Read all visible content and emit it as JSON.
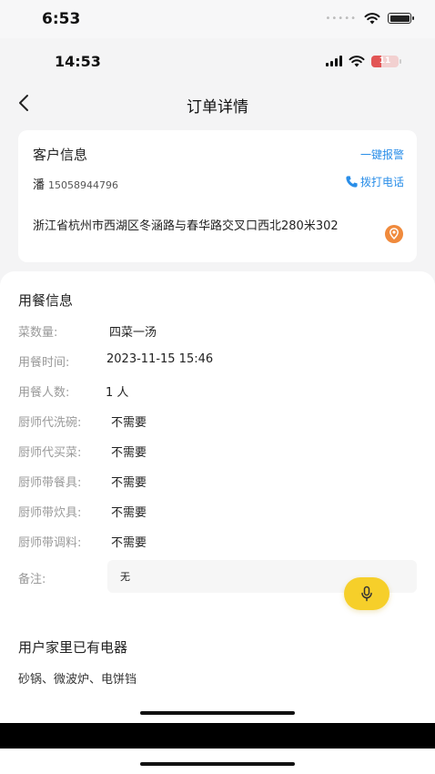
{
  "outer_status": {
    "time": "6:53",
    "dots": "•••••"
  },
  "inner_status": {
    "time": "14:53",
    "battery": "11"
  },
  "nav": {
    "title": "订单详情"
  },
  "customer": {
    "title": "客户信息",
    "alarm": "一键报警",
    "name": "潘",
    "phone": "15058944796",
    "call": "拨打电话",
    "address": "浙江省杭州市西湖区冬涵路与春华路交叉口西北280米302"
  },
  "meal": {
    "title": "用餐信息",
    "rows": [
      {
        "label": "菜数量:",
        "value": "四菜一汤"
      },
      {
        "label": "用餐时间:",
        "value": "2023-11-15 15:46"
      },
      {
        "label": "用餐人数:",
        "value": "1 人"
      },
      {
        "label": "厨师代洗碗:",
        "value": "不需要"
      },
      {
        "label": "厨师代买菜:",
        "value": "不需要"
      },
      {
        "label": "厨师带餐具:",
        "value": "不需要"
      },
      {
        "label": "厨师带炊具:",
        "value": "不需要"
      },
      {
        "label": "厨师带调料:",
        "value": "不需要"
      }
    ],
    "remark_label": "备注:",
    "remark_value": "无"
  },
  "appliances": {
    "title": "用户家里已有电器",
    "value": "砂锅、微波炉、电饼铛"
  },
  "colors": {
    "accent_blue": "#2a8ee8",
    "location_orange": "#f08a3c",
    "mic_yellow": "#f6cf2a"
  }
}
